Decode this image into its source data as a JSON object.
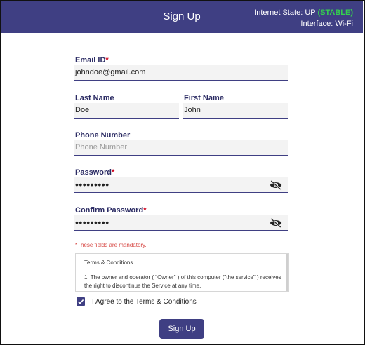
{
  "header": {
    "title": "Sign Up",
    "internet_state_label": "Internet State: UP",
    "internet_state_status": "(STABLE)",
    "interface": "Interface:  Wi-Fi"
  },
  "form": {
    "email": {
      "label": "Email ID",
      "value": "johndoe@gmail.com"
    },
    "last_name": {
      "label": "Last Name",
      "value": "Doe"
    },
    "first_name": {
      "label": "First Name",
      "value": "John"
    },
    "phone": {
      "label": "Phone Number",
      "placeholder": "Phone Number"
    },
    "password": {
      "label": "Password",
      "value": "•••••••••"
    },
    "confirm_password": {
      "label": "Confirm Password",
      "value": "•••••••••"
    },
    "required_mark": "*",
    "mandatory_note": "*These fields are mandatory."
  },
  "terms": {
    "title": "Terms & Conditions",
    "body": "1. The owner and operator ( \"Owner\" ) of this computer (\"the service\" ) receives the right to discontinue the Service at any time."
  },
  "agree": {
    "label": "I Agree to the Terms & Conditions",
    "checked": true
  },
  "submit": {
    "label": "Sign Up"
  },
  "colors": {
    "primary": "#3f3f83",
    "stable": "#35d04f",
    "error": "#d64541"
  }
}
